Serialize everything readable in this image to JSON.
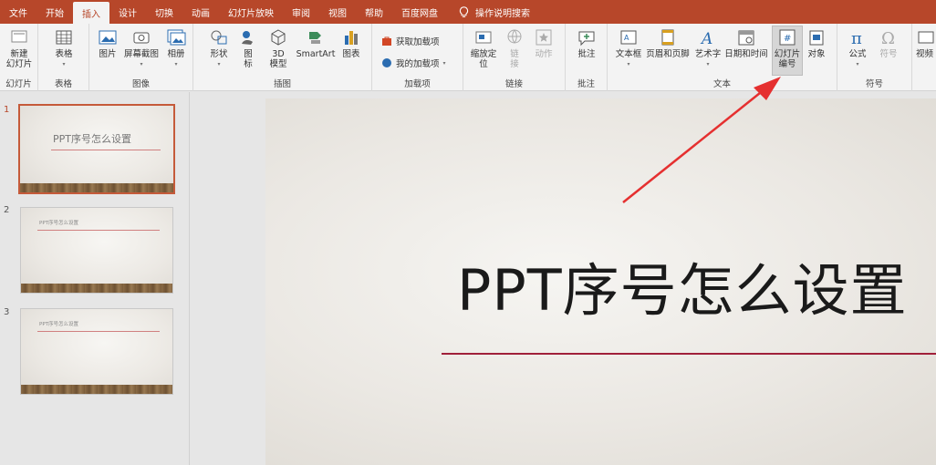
{
  "menu": {
    "tabs": [
      "文件",
      "开始",
      "插入",
      "设计",
      "切换",
      "动画",
      "幻灯片放映",
      "审阅",
      "视图",
      "帮助",
      "百度网盘"
    ],
    "active_index": 2,
    "tell_me": "操作说明搜索"
  },
  "ribbon": {
    "slides": {
      "new_slide_line1": "新建",
      "new_slide_line2": "幻灯片",
      "label": "幻灯片"
    },
    "tables": {
      "table": "表格",
      "label": "表格"
    },
    "images": {
      "picture": "图片",
      "screenshot": "屏幕截图",
      "album": "相册",
      "label": "图像"
    },
    "illustrations": {
      "shapes": "形状",
      "icons_line1": "图",
      "icons_line2": "标",
      "model_line1": "3D",
      "model_line2": "模型",
      "smartart": "SmartArt",
      "chart": "图表",
      "label": "插图"
    },
    "addins": {
      "get": "获取加载项",
      "mine": "我的加载项",
      "label": "加载项"
    },
    "links": {
      "zoom_line1": "缩放定",
      "zoom_line2": "位",
      "link_line1": "链",
      "link_line2": "接",
      "action": "动作",
      "label": "链接"
    },
    "comments": {
      "comment": "批注",
      "label": "批注"
    },
    "text": {
      "textbox": "文本框",
      "header_footer": "页眉和页脚",
      "wordart": "艺术字",
      "datetime": "日期和时间",
      "slide_number_line1": "幻灯片",
      "slide_number_line2": "编号",
      "object": "对象",
      "label": "文本"
    },
    "symbols": {
      "equation": "公式",
      "symbol": "符号",
      "label": "符号"
    },
    "media": {
      "video": "视频"
    }
  },
  "slides": [
    {
      "number": "1",
      "title": "PPT序号怎么设置"
    },
    {
      "number": "2",
      "title": "PPT序号怎么设置"
    },
    {
      "number": "3",
      "title": "PPT序号怎么设置"
    }
  ],
  "main_slide": {
    "title": "PPT序号怎么设置"
  },
  "colors": {
    "accent": "#b7472a",
    "annotation_arrow": "#e53030",
    "title_rule": "#a0203a"
  }
}
